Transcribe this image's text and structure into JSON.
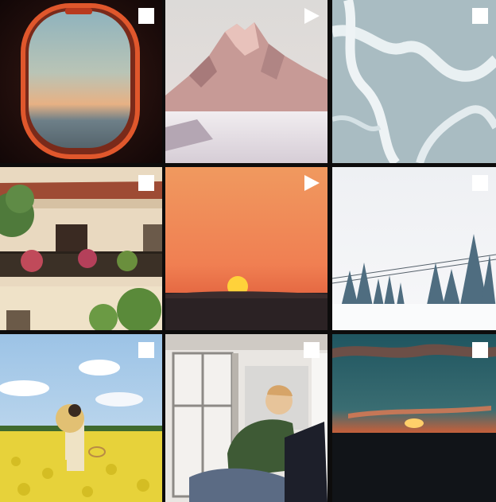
{
  "feed": {
    "background": "#0d0c0c",
    "tiles": [
      {
        "name": "airplane-window-sunset",
        "badge": "multi-photo-icon"
      },
      {
        "name": "snowy-mountain-peak",
        "badge": "play-icon"
      },
      {
        "name": "frozen-river-aerial",
        "badge": "multi-photo-icon"
      },
      {
        "name": "balcony-house-flowers",
        "badge": "multi-photo-icon"
      },
      {
        "name": "orange-sky-sunset",
        "badge": "play-icon"
      },
      {
        "name": "snowy-forest-ski-lift",
        "badge": "multi-photo-icon"
      },
      {
        "name": "woman-in-rapeseed-field",
        "badge": "multi-photo-icon"
      },
      {
        "name": "couple-at-open-window",
        "badge": "multi-photo-icon"
      },
      {
        "name": "sunset-over-sea",
        "badge": "multi-photo-icon"
      }
    ]
  }
}
